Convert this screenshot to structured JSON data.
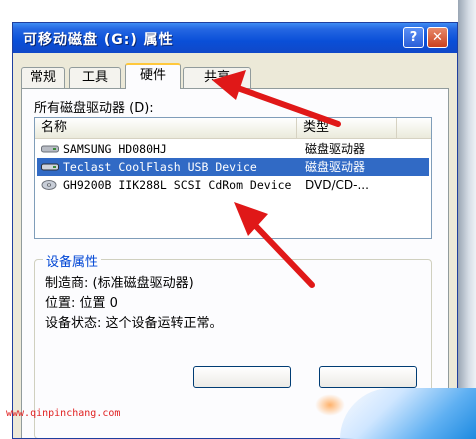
{
  "window": {
    "title": "可移动磁盘 (G:) 属性",
    "help_label": "?",
    "close_label": "✕"
  },
  "tabs": [
    {
      "label": "常规"
    },
    {
      "label": "工具"
    },
    {
      "label": "硬件",
      "selected": true
    },
    {
      "label": "共享"
    }
  ],
  "drives": {
    "label": "所有磁盘驱动器 (D):",
    "columns": [
      "名称",
      "类型"
    ],
    "rows": [
      {
        "name": "SAMSUNG HD080HJ",
        "type": "磁盘驱动器",
        "icon": "disk-drive-icon"
      },
      {
        "name": "Teclast CoolFlash USB Device",
        "type": "磁盘驱动器",
        "icon": "usb-drive-icon",
        "selected": true
      },
      {
        "name": "GH9200B IIK288L SCSI CdRom Device",
        "type": "DVD/CD-...",
        "icon": "cdrom-icon"
      }
    ]
  },
  "properties": {
    "title": "设备属性",
    "manufacturer": "制造商: (标准磁盘驱动器)",
    "location": "位置: 位置 0",
    "status": "设备状态: 这个设备运转正常。"
  },
  "watermark": "www.qinpinchang.com",
  "colors": {
    "titlebar": "#0a4fd8",
    "selection": "#316ac5",
    "annotation_arrow": "#e01818"
  }
}
